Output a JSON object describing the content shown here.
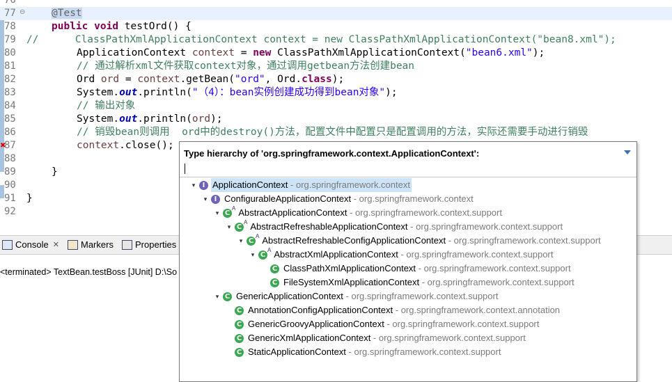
{
  "editor": {
    "lines": [
      {
        "num": "76",
        "code": ""
      },
      {
        "num": "77",
        "code": "@Test"
      },
      {
        "num": "78",
        "code": "public void testOrd() {"
      },
      {
        "num": "79",
        "code": "//      ClassPathXmlApplicationContext context = new ClassPathXmlApplicationContext(\"bean8.xml\");"
      },
      {
        "num": "80",
        "code": "ApplicationContext context = new ClassPathXmlApplicationContext(\"bean6.xml\");"
      },
      {
        "num": "81",
        "code": "// 通过解析xml文件获取context对象，通过调用getbean方法创建bean"
      },
      {
        "num": "82",
        "code": "Ord ord = context.getBean(\"ord\", Ord.class);"
      },
      {
        "num": "83",
        "code": "System.out.println(\"（4）：bean实例创建成功得到bean对象\");"
      },
      {
        "num": "84",
        "code": "// 输出对象"
      },
      {
        "num": "85",
        "code": "System.out.println(ord);"
      },
      {
        "num": "86",
        "code": "// 销毁bean则调用  ord中的destroy()方法，配置文件中配置只是配置调用的方法，实际还需要手动进行销毁"
      },
      {
        "num": "87",
        "code": "context.close();"
      },
      {
        "num": "88",
        "code": ""
      },
      {
        "num": "89",
        "code": "}"
      },
      {
        "num": "90",
        "code": ""
      },
      {
        "num": "91",
        "code": "}"
      },
      {
        "num": "92",
        "code": ""
      }
    ]
  },
  "views": {
    "tabs": [
      {
        "label": "Console"
      },
      {
        "label": "Markers"
      },
      {
        "label": "Properties"
      }
    ],
    "console_text": "<terminated> TextBean.testBoss [JUnit] D:\\So"
  },
  "popup": {
    "title": "Type hierarchy of 'org.springframework.context.ApplicationContext':",
    "filter_value": "",
    "nodes": [
      {
        "name": "ApplicationContext",
        "pkg": " - org.springframework.context",
        "kind": "interface",
        "abstract": false,
        "expanded": true,
        "depth": 0,
        "selected": true
      },
      {
        "name": "ConfigurableApplicationContext",
        "pkg": " - org.springframework.context",
        "kind": "interface",
        "abstract": false,
        "expanded": true,
        "depth": 1,
        "selected": false
      },
      {
        "name": "AbstractApplicationContext",
        "pkg": " - org.springframework.context.support",
        "kind": "class",
        "abstract": true,
        "expanded": true,
        "depth": 2,
        "selected": false
      },
      {
        "name": "AbstractRefreshableApplicationContext",
        "pkg": " - org.springframework.context.support",
        "kind": "class",
        "abstract": true,
        "expanded": true,
        "depth": 3,
        "selected": false
      },
      {
        "name": "AbstractRefreshableConfigApplicationContext",
        "pkg": " - org.springframework.context.support",
        "kind": "class",
        "abstract": true,
        "expanded": true,
        "depth": 4,
        "selected": false
      },
      {
        "name": "AbstractXmlApplicationContext",
        "pkg": " - org.springframework.context.support",
        "kind": "class",
        "abstract": true,
        "expanded": true,
        "depth": 5,
        "selected": false
      },
      {
        "name": "ClassPathXmlApplicationContext",
        "pkg": " - org.springframework.context.support",
        "kind": "class",
        "abstract": false,
        "expanded": false,
        "depth": 6,
        "selected": false
      },
      {
        "name": "FileSystemXmlApplicationContext",
        "pkg": " - org.springframework.context.support",
        "kind": "class",
        "abstract": false,
        "expanded": false,
        "depth": 6,
        "selected": false
      },
      {
        "name": "GenericApplicationContext",
        "pkg": " - org.springframework.context.support",
        "kind": "class",
        "abstract": false,
        "expanded": true,
        "depth": 2,
        "selected": false
      },
      {
        "name": "AnnotationConfigApplicationContext",
        "pkg": " - org.springframework.context.annotation",
        "kind": "class",
        "abstract": false,
        "expanded": false,
        "depth": 3,
        "selected": false
      },
      {
        "name": "GenericGroovyApplicationContext",
        "pkg": " - org.springframework.context.support",
        "kind": "class",
        "abstract": false,
        "expanded": false,
        "depth": 3,
        "selected": false
      },
      {
        "name": "GenericXmlApplicationContext",
        "pkg": " - org.springframework.context.support",
        "kind": "class",
        "abstract": false,
        "expanded": false,
        "depth": 3,
        "selected": false
      },
      {
        "name": "StaticApplicationContext",
        "pkg": " - org.springframework.context.support",
        "kind": "class",
        "abstract": false,
        "expanded": false,
        "depth": 3,
        "selected": false
      }
    ]
  },
  "colors": {
    "keyword": "#7f0055",
    "string": "#2a00ff",
    "comment": "#3f7f5f",
    "selection": "#cce4f7"
  }
}
